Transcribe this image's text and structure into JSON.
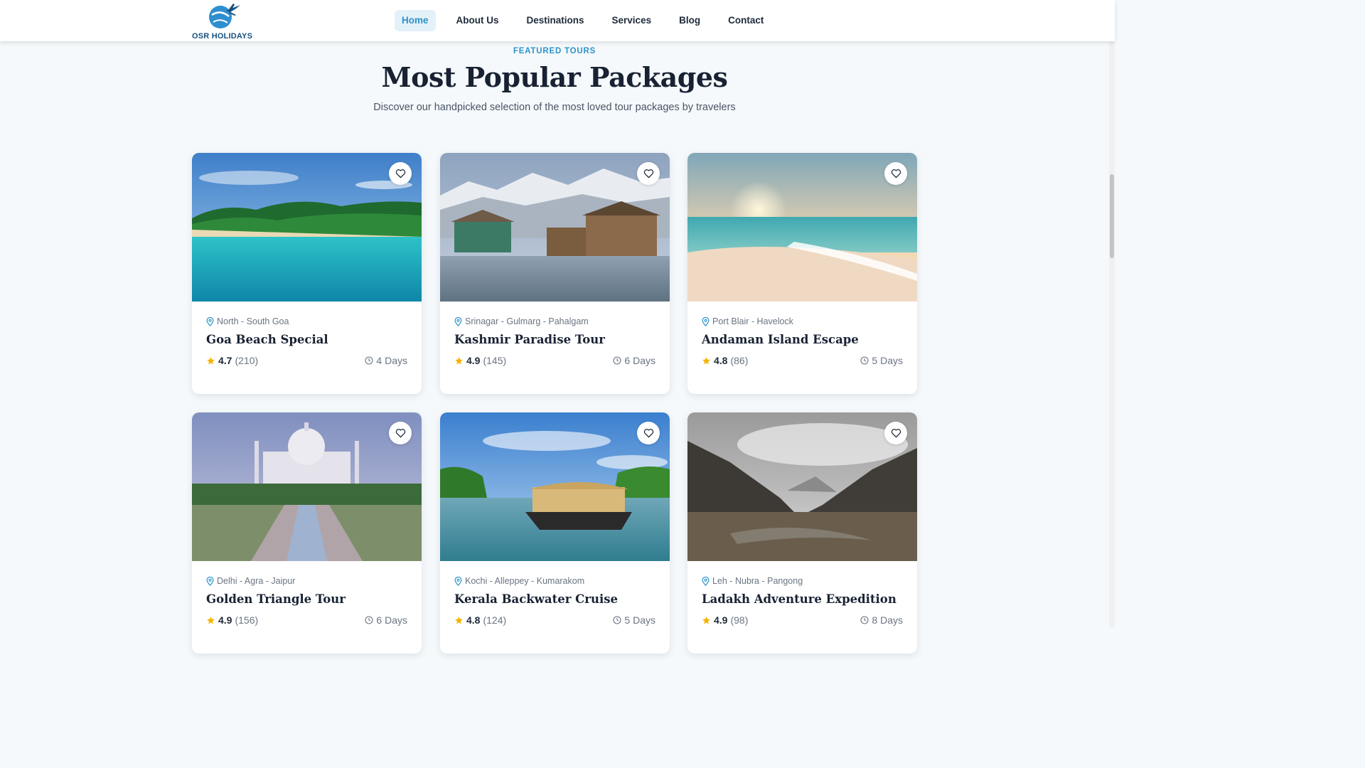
{
  "brand": {
    "name": "OSR HOLIDAYS",
    "color": "#2c93c9"
  },
  "nav": {
    "items": [
      {
        "label": "Home",
        "active": true
      },
      {
        "label": "About Us",
        "active": false
      },
      {
        "label": "Destinations",
        "active": false
      },
      {
        "label": "Services",
        "active": false
      },
      {
        "label": "Blog",
        "active": false
      },
      {
        "label": "Contact",
        "active": false
      }
    ]
  },
  "section": {
    "eyebrow": "FEATURED TOURS",
    "title": "Most Popular Packages",
    "subtitle": "Discover our handpicked selection of the most loved tour packages by travelers"
  },
  "packages": [
    {
      "location": "North - South Goa",
      "title": "Goa Beach Special",
      "rating": "4.7",
      "reviews": "(210)",
      "duration": "4 Days",
      "image": "goa-beach-photo"
    },
    {
      "location": "Srinagar - Gulmarg - Pahalgam",
      "title": "Kashmir Paradise Tour",
      "rating": "4.9",
      "reviews": "(145)",
      "duration": "6 Days",
      "image": "kashmir-houseboats-photo"
    },
    {
      "location": "Port Blair - Havelock",
      "title": "Andaman Island Escape",
      "rating": "4.8",
      "reviews": "(86)",
      "duration": "5 Days",
      "image": "andaman-sunset-beach-photo"
    },
    {
      "location": "Delhi - Agra - Jaipur",
      "title": "Golden Triangle Tour",
      "rating": "4.9",
      "reviews": "(156)",
      "duration": "6 Days",
      "image": "taj-mahal-photo"
    },
    {
      "location": "Kochi - Alleppey - Kumarakom",
      "title": "Kerala Backwater Cruise",
      "rating": "4.8",
      "reviews": "(124)",
      "duration": "5 Days",
      "image": "kerala-houseboat-photo"
    },
    {
      "location": "Leh - Nubra - Pangong",
      "title": "Ladakh Adventure Expedition",
      "rating": "4.9",
      "reviews": "(98)",
      "duration": "8 Days",
      "image": "ladakh-valley-photo"
    }
  ],
  "icons": {
    "favorite": "heart-icon",
    "location": "map-pin-icon",
    "rating": "star-icon",
    "duration": "clock-icon"
  },
  "colors": {
    "accent": "#2c93c9",
    "star": "#f5b400",
    "heading": "#182233"
  }
}
